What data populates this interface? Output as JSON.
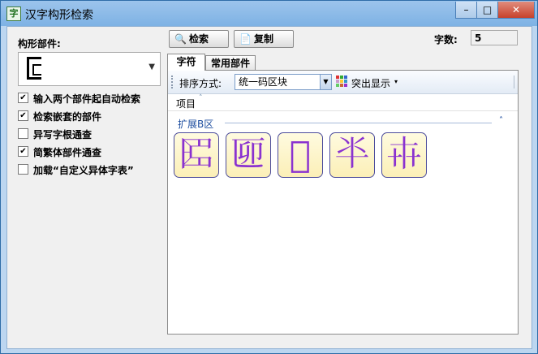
{
  "window": {
    "title": "汉字构形检索",
    "app_icon": "字",
    "minimize_label": "–",
    "maximize_label": "□",
    "close_label": "✕"
  },
  "left": {
    "parts_label": "构形部件:",
    "part_combo_icon": "component-glyph-icon",
    "options": [
      {
        "label": "输入两个部件起自动检索",
        "checked": true
      },
      {
        "label": "检索嵌套的部件",
        "checked": true
      },
      {
        "label": "异写字根通查",
        "checked": false
      },
      {
        "label": "简繁体部件通查",
        "checked": true
      },
      {
        "label": "加载“自定义异体字表”",
        "checked": false
      }
    ]
  },
  "toolbar": {
    "search_label": "检索",
    "search_icon": "🔍",
    "copy_label": "复制",
    "copy_icon": "📄",
    "count_label": "字数:",
    "count_value": "5"
  },
  "tabs": [
    {
      "label": "字符",
      "active": true
    },
    {
      "label": "常用部件",
      "active": false
    }
  ],
  "results": {
    "sort_label": "排序方式:",
    "sort_value": "统一码区块",
    "highlight_label": "突出显示",
    "highlight_arrow": "▾",
    "column_header": "项目",
    "group_title": "扩展B区",
    "group_collapse": "˄",
    "characters": [
      "𠥓",
      "𠥰",
      "𠦁",
      "𠦂",
      "𠦃"
    ],
    "glyph_color": "#8a32d0",
    "tile_border_color": "#4c4c9c"
  }
}
